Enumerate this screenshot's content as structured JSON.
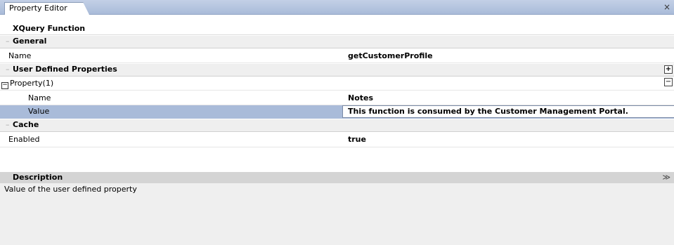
{
  "tab": {
    "label": "Property Editor",
    "close": "×"
  },
  "object_title": "XQuery Function",
  "sections": {
    "general": {
      "label": "General",
      "name_key": "Name",
      "name_value": "getCustomerProfile"
    },
    "user_defined": {
      "label": "User Defined Properties",
      "property_group": "Property(1)",
      "name_key": "Name",
      "name_value": "Notes",
      "value_key": "Value",
      "value_value": "This function is consumed by the Customer Management Portal."
    },
    "cache": {
      "label": "Cache",
      "enabled_key": "Enabled",
      "enabled_value": "true"
    }
  },
  "description": {
    "title": "Description",
    "text": "Value of the user defined property"
  },
  "colors": {
    "selection": "#a9bbd9",
    "tab_bar": "#b8c7e0",
    "description_bg": "#efefef"
  }
}
